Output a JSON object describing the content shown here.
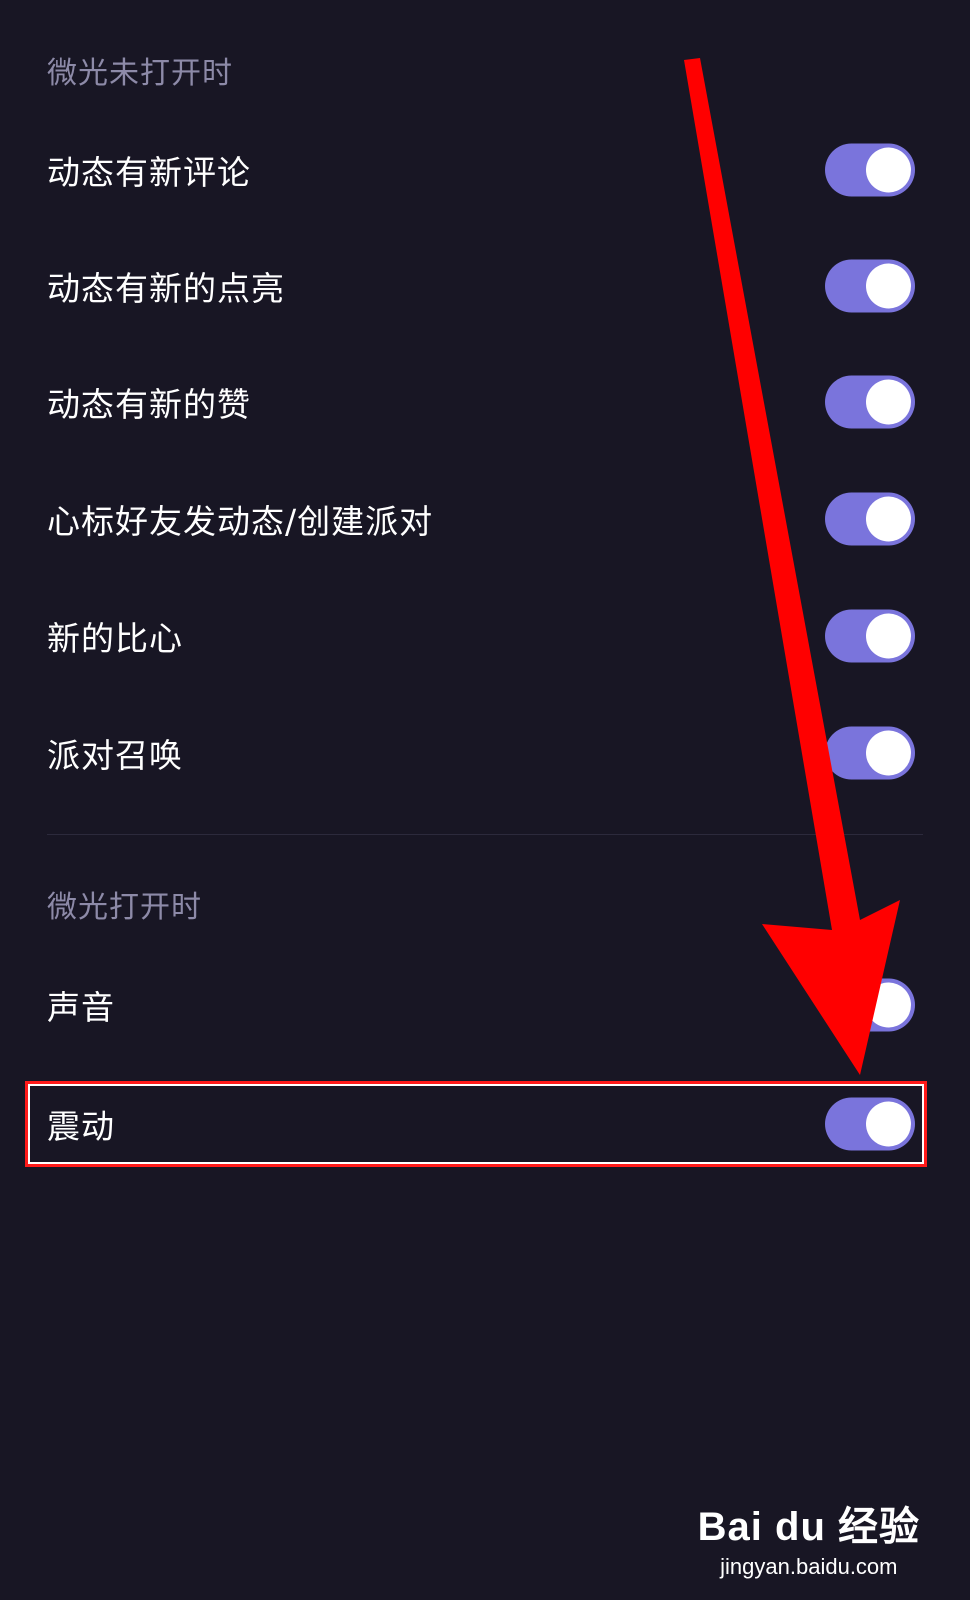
{
  "section_off": {
    "header": "微光未打开时",
    "items": [
      {
        "label": "动态有新评论",
        "enabled": true
      },
      {
        "label": "动态有新的点亮",
        "enabled": true
      },
      {
        "label": "动态有新的赞",
        "enabled": true
      },
      {
        "label": "心标好友发动态/创建派对",
        "enabled": true
      },
      {
        "label": "新的比心",
        "enabled": true
      },
      {
        "label": "派对召唤",
        "enabled": true
      }
    ]
  },
  "section_on": {
    "header": "微光打开时",
    "items": [
      {
        "label": "声音",
        "enabled": true
      },
      {
        "label": "震动",
        "enabled": true
      }
    ]
  },
  "annotation": {
    "highlight_color": "#ff1a1a",
    "arrow_color": "#ff0000"
  },
  "watermark": {
    "logo": "Bai du 经验",
    "url": "jingyan.baidu.com"
  },
  "colors": {
    "background": "#181624",
    "toggle_on": "#7a74dc",
    "header_text": "#8d8aa8"
  }
}
